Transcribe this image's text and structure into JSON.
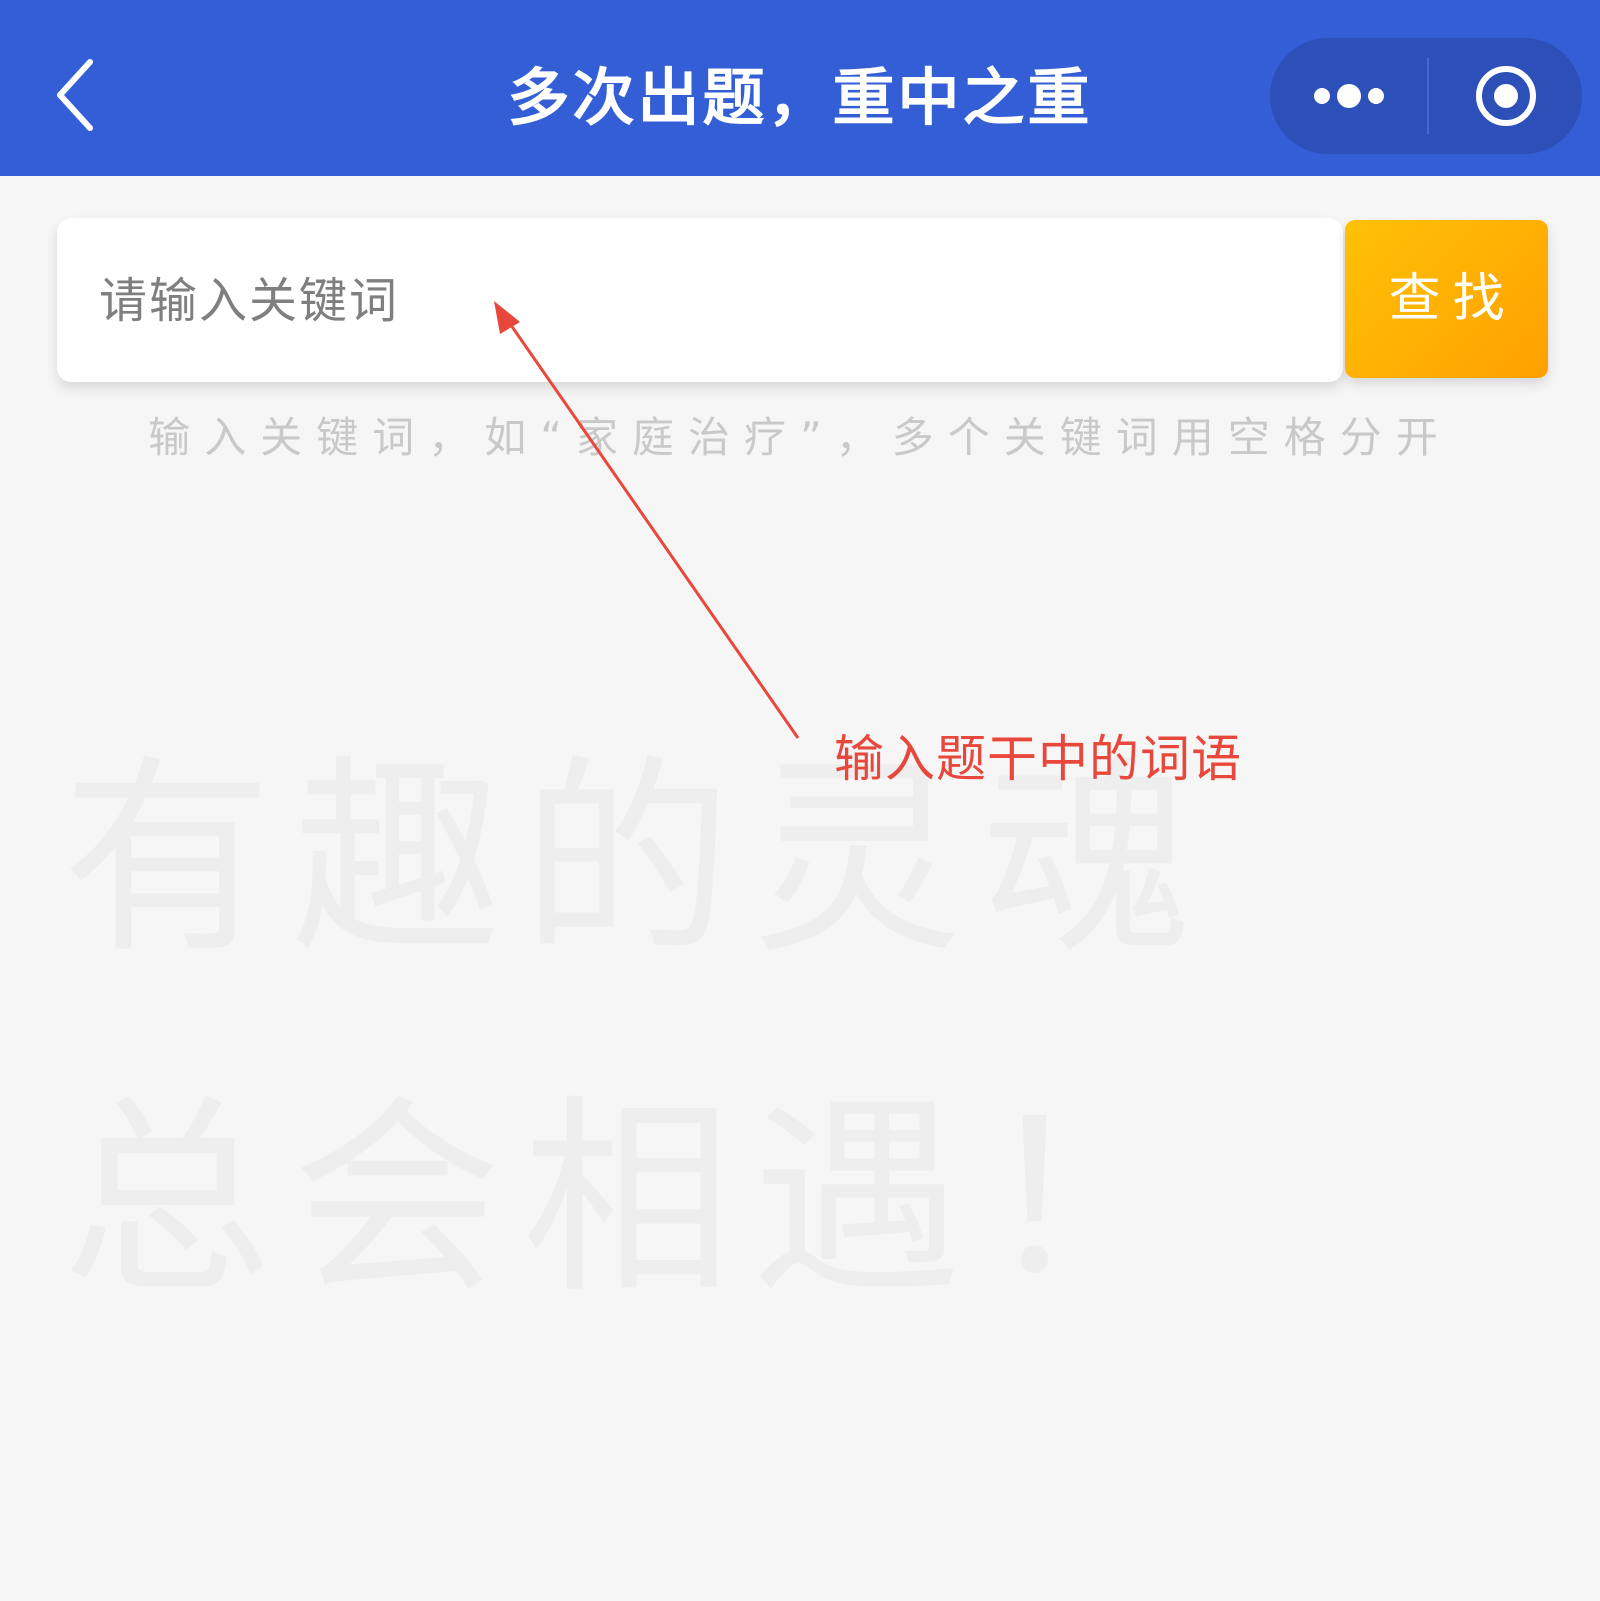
{
  "navbar": {
    "title": "多次出题，重中之重",
    "back_icon": "chevron-left-icon",
    "more_icon": "more-dots-icon",
    "target_icon": "target-circle-icon",
    "background_color": "#345ed6"
  },
  "search": {
    "placeholder": "请输入关键词",
    "value": "",
    "button_label": "查找",
    "button_color": "#ffb300",
    "hint": "输入关键词，如“家庭治疗”，多个关键词用空格分开"
  },
  "annotation": {
    "text": "输入题干中的词语",
    "color": "#e8483b"
  },
  "watermark": {
    "text": "有趣的灵魂总会相遇！"
  }
}
